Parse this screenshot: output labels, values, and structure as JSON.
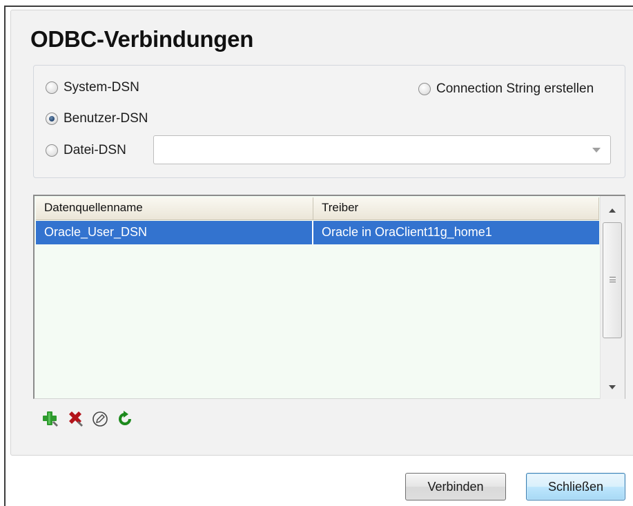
{
  "dialog": {
    "title": "ODBC-Verbindungen"
  },
  "dsn_options": {
    "system_dsn": {
      "label": "System-DSN",
      "checked": false
    },
    "user_dsn": {
      "label": "Benutzer-DSN",
      "checked": true
    },
    "file_dsn": {
      "label": "Datei-DSN",
      "checked": false
    },
    "connection_string": {
      "label": "Connection String erstellen",
      "checked": false
    },
    "file_dsn_select_value": ""
  },
  "datasource_table": {
    "columns": [
      "Datenquellenname",
      "Treiber"
    ],
    "rows": [
      {
        "name": "Oracle_User_DSN",
        "driver": "Oracle in OraClient11g_home1",
        "selected": true
      }
    ]
  },
  "toolbar": {
    "icons": [
      "add-icon",
      "delete-icon",
      "edit-icon",
      "refresh-icon"
    ],
    "colors": {
      "add": "#2e9a2e",
      "delete": "#b3141b",
      "edit": "#444444",
      "refresh": "#1d8a1d"
    }
  },
  "buttons": {
    "connect": "Verbinden",
    "close": "Schließen"
  },
  "colors": {
    "selection": "#3373cf",
    "list_background": "#f4fbf4"
  }
}
